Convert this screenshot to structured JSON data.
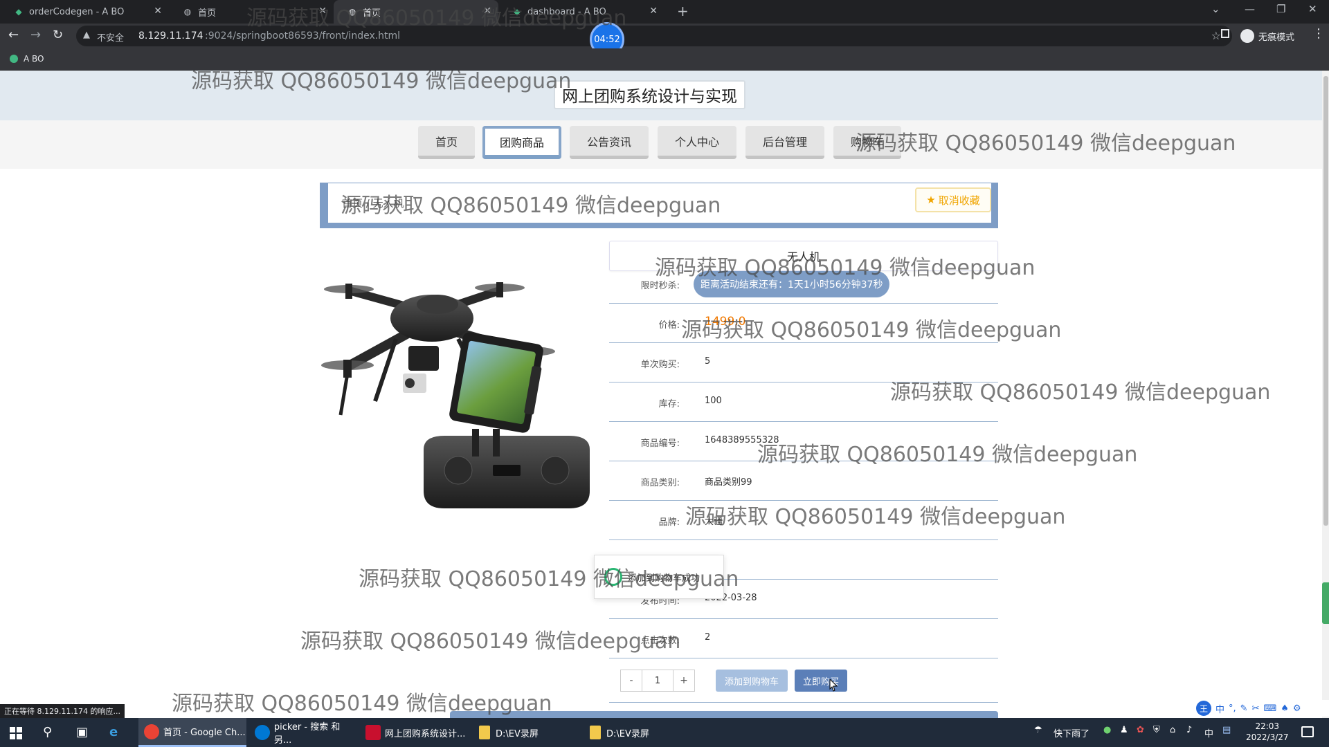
{
  "browser": {
    "tabs": [
      {
        "title": "orderCodegen - A BO",
        "icon": "vue-icon",
        "active": false
      },
      {
        "title": "首页",
        "icon": "globe-icon",
        "active": false
      },
      {
        "title": "首页",
        "icon": "globe-icon",
        "active": true
      },
      {
        "title": "dashboard - A BO",
        "icon": "vue-icon",
        "active": false
      }
    ],
    "insecure_label": "不安全",
    "url_host": "8.129.11.174",
    "url_path": ":9024/springboot86593/front/index.html",
    "incognito_label": "无痕模式",
    "bookmark": "A BO",
    "recording_timer": "04:52",
    "status_text": "正在等待 8.129.11.174 的响应..."
  },
  "site": {
    "title": "网上团购系统设计与实现",
    "nav": [
      {
        "label": "首页",
        "active": false
      },
      {
        "label": "团购商品",
        "active": true
      },
      {
        "label": "公告资讯",
        "active": false
      },
      {
        "label": "个人中心",
        "active": false
      },
      {
        "label": "后台管理",
        "active": false
      },
      {
        "label": "购物车",
        "active": false
      }
    ]
  },
  "detail": {
    "breadcrumb": "首页 / 无人机",
    "favorite_button": "取消收藏",
    "product_name": "无人机",
    "flash_sale_label": "限时秒杀:",
    "countdown": "距离活动结束还有：1天1小时56分钟37秒",
    "fields": [
      {
        "label": "价格:",
        "value": "1499.0",
        "type": "price"
      },
      {
        "label": "单次购买:",
        "value": "5"
      },
      {
        "label": "库存:",
        "value": "100"
      },
      {
        "label": "商品编号:",
        "value": "1648389555328"
      },
      {
        "label": "商品类别:",
        "value": "商品类别99"
      },
      {
        "label": "品牌:",
        "value": "大疆"
      },
      {
        "label": "",
        "value": ""
      },
      {
        "label": "发布时间:",
        "value": "2022-03-28"
      },
      {
        "label": "点击次数:",
        "value": "2"
      }
    ],
    "quantity": "1",
    "minus": "-",
    "plus": "+",
    "add_to_cart": "添加到购物车",
    "buy_now": "立即购买",
    "toast": "添加到购物车成功"
  },
  "watermark_text": "源码获取 QQ86050149 微信deepguan",
  "ime": {
    "logo": "王",
    "mode": "中"
  },
  "taskbar": {
    "tasks": [
      {
        "label": "首页 - Google Ch...",
        "icon_color": "#ea4335",
        "active": true
      },
      {
        "label": "picker - 搜索 和另...",
        "icon_color": "#0078d4",
        "active": false
      },
      {
        "label": "网上团购系统设计...",
        "icon_color": "#c8102e",
        "active": false
      },
      {
        "label": "D:\\EV录屏",
        "icon_color": "#f2c94c",
        "active": false
      },
      {
        "label": "D:\\EV录屏",
        "icon_color": "#f2c94c",
        "active": false
      }
    ],
    "weather": "快下雨了",
    "lang": "中",
    "time": "22:03",
    "date": "2022/3/27"
  }
}
